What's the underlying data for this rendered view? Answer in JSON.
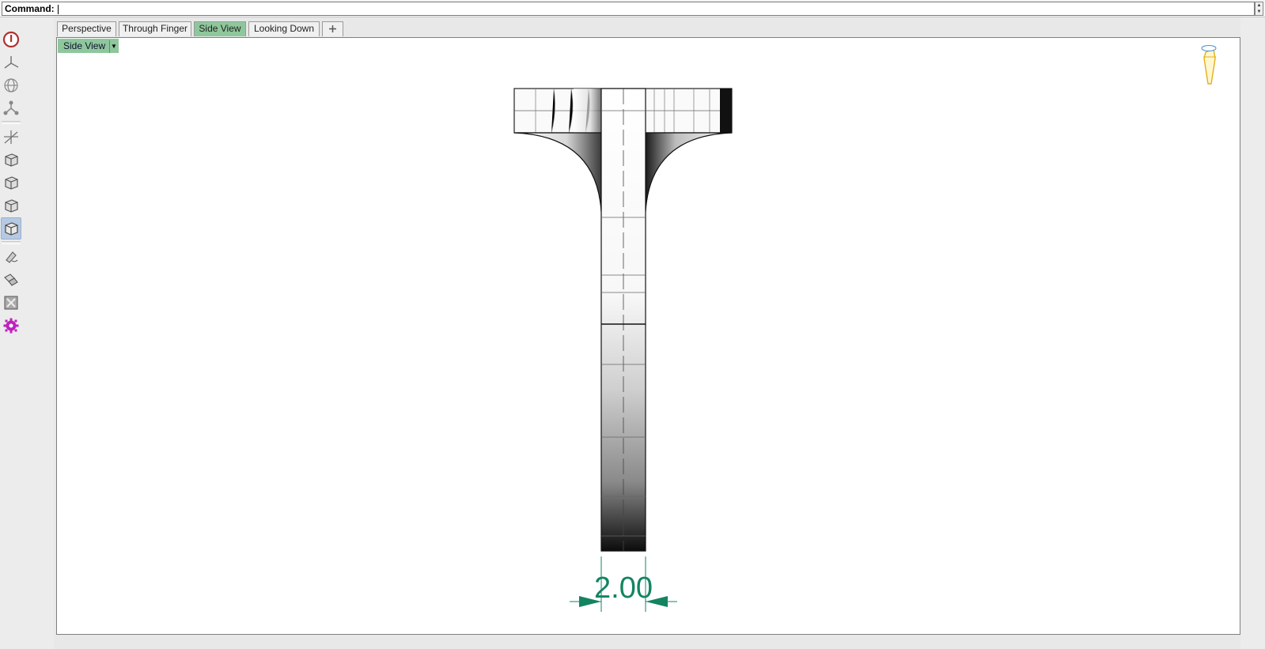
{
  "command_bar": {
    "label": "Command:",
    "value": ""
  },
  "tabs": [
    {
      "label": "Perspective",
      "active": false
    },
    {
      "label": "Through Finger",
      "active": false
    },
    {
      "label": "Side View",
      "active": true
    },
    {
      "label": "Looking Down",
      "active": false
    }
  ],
  "add_tab_icon": "plus-icon",
  "viewport": {
    "name": "Side View",
    "dimension": {
      "text": "2.00"
    }
  },
  "toolbar": {
    "tools": [
      "power-icon",
      "three-way-arrows-icon",
      "globe-icon",
      "molecule-icon",
      "axis-transform-icon",
      "cube-icon",
      "cube-icon",
      "cube-icon",
      "cube-icon",
      "brush-icon",
      "layers-icon",
      "block-icon",
      "gear-icon"
    ]
  },
  "colors": {
    "active_tab": "#8ec79b",
    "dimension": "#138460",
    "power_icon": "#c0392b",
    "gear_icon": "#c020c0",
    "gumball": "#f0c020"
  }
}
